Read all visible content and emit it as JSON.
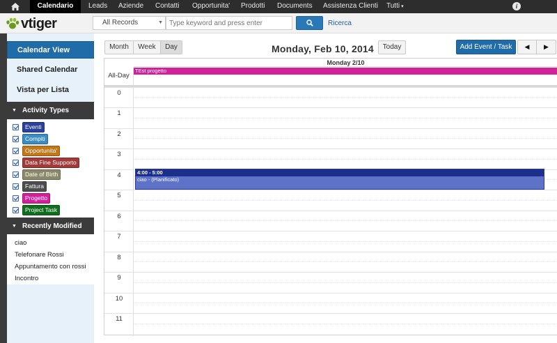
{
  "topnav": {
    "items": [
      {
        "label": "Calendario",
        "active": true
      },
      {
        "label": "Leads"
      },
      {
        "label": "Aziende"
      },
      {
        "label": "Contatti"
      },
      {
        "label": "Opportunita'"
      },
      {
        "label": "Prodotti"
      },
      {
        "label": "Documents"
      },
      {
        "label": "Assistenza Clienti"
      },
      {
        "label": "Tutti"
      }
    ],
    "icons": [
      "home-icon",
      "info-icon"
    ]
  },
  "header": {
    "logo_text": "vtiger",
    "record_filter": "All Records",
    "search_placeholder": "Type keyword and press enter",
    "search_link": "Ricerca"
  },
  "sidebar": {
    "items": [
      {
        "label": "Calendar View",
        "active": true
      },
      {
        "label": "Shared Calendar"
      },
      {
        "label": "Vista per Lista"
      }
    ],
    "activity_types_title": "Activity Types",
    "activity_types": [
      {
        "label": "Eventi",
        "color": "#2a3f9e",
        "checked": true
      },
      {
        "label": "Compiti",
        "color": "#3a8dc3",
        "checked": true
      },
      {
        "label": "Opportunita'",
        "color": "#c47718",
        "checked": true
      },
      {
        "label": "Data Fine Supporto",
        "color": "#a23a3a",
        "checked": true
      },
      {
        "label": "Date of Birth",
        "color": "#8a8a6a",
        "checked": true
      },
      {
        "label": "Fattura",
        "color": "#4d4d4d",
        "checked": true
      },
      {
        "label": "Progetto",
        "color": "#d3209a",
        "checked": true
      },
      {
        "label": "Project Task",
        "color": "#0f6e1d",
        "checked": true
      }
    ],
    "recent_title": "Recently Modified",
    "recent_items": [
      "ciao",
      "Telefonare Rossi",
      "Appuntamento con rossi",
      "Incontro"
    ]
  },
  "toolbar": {
    "views": [
      {
        "label": "Month"
      },
      {
        "label": "Week"
      },
      {
        "label": "Day",
        "active": true
      }
    ],
    "date_title": "Monday, Feb 10, 2014",
    "today_label": "Today",
    "add_label": "Add Event / Task",
    "prev_label": "◀",
    "next_label": "▶"
  },
  "calendar": {
    "day_header": "Monday 2/10",
    "allday_label": "All-Day",
    "allday_event": {
      "title": "TEst progetto",
      "color": "#d3209a"
    },
    "hours": [
      "0",
      "1",
      "2",
      "3",
      "4",
      "5",
      "6",
      "7",
      "8",
      "9",
      "10",
      "11"
    ],
    "event": {
      "time": "4:00 - 5:00",
      "title": "ciao - (Planificato)",
      "color": "#5e72c7"
    }
  }
}
